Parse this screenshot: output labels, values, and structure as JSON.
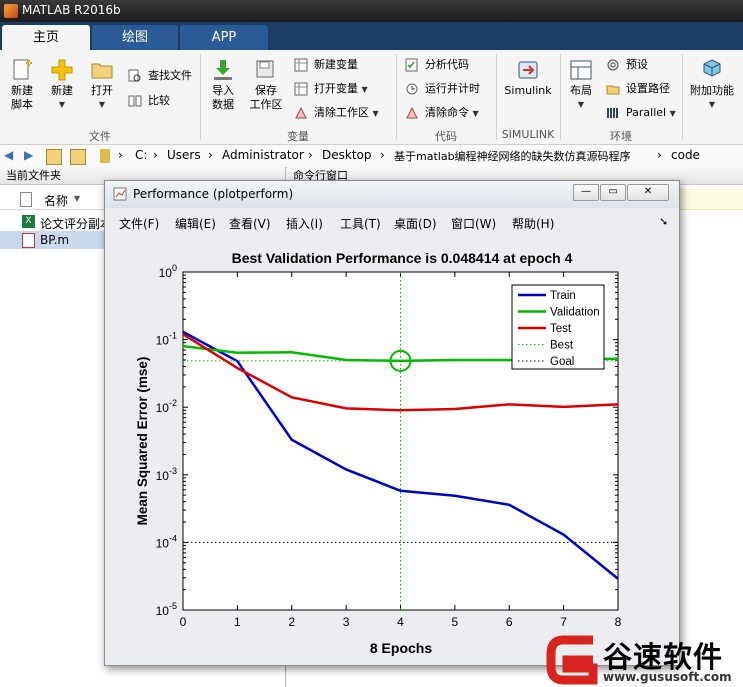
{
  "window": {
    "title": "MATLAB R2016b"
  },
  "tabs": [
    {
      "label": "主页"
    },
    {
      "label": "绘图"
    },
    {
      "label": "APP"
    }
  ],
  "ribbon": {
    "new_script": "新建\n脚本",
    "new": "新建",
    "open": "打开",
    "find_files": "查找文件",
    "compare": "比较",
    "import_data": "导入\n数据",
    "save_workspace": "保存\n工作区",
    "new_variable": "新建变量",
    "open_variable": "打开变量",
    "clear_workspace": "清除工作区",
    "analyze_code": "分析代码",
    "run_and_time": "运行并计时",
    "clear_commands": "清除命令",
    "simulink": "Simulink",
    "layout": "布局",
    "preferences": "预设",
    "set_path": "设置路径",
    "parallel": "Parallel",
    "addons": "附加功能",
    "groups": {
      "file": "文件",
      "variable": "变量",
      "code": "代码",
      "simulink": "SIMULINK",
      "environment": "环境"
    }
  },
  "address": {
    "crumbs": [
      "C:",
      "Users",
      "Administrator",
      "Desktop",
      "基于matlab编程神经网络的缺失数仿真源码程序",
      "code"
    ]
  },
  "left_panel": {
    "title": "当前文件夹",
    "col_name": "名称",
    "files": [
      {
        "name": "论文评分副本",
        "icon": "excel-icon"
      },
      {
        "name": "BP.m",
        "icon": "m-file-icon",
        "selected": true
      }
    ]
  },
  "cmd_panel": {
    "title": "命令行窗口"
  },
  "figure": {
    "title": "Performance (plotperform)",
    "menu": [
      "文件(F)",
      "编辑(E)",
      "查看(V)",
      "插入(I)",
      "工具(T)",
      "桌面(D)",
      "窗口(W)",
      "帮助(H)"
    ],
    "btn_min": "—",
    "btn_max": "▭",
    "btn_close": "✕"
  },
  "chart_data": {
    "type": "line",
    "title": "Best Validation Performance is 0.048414 at epoch 4",
    "xlabel": "8 Epochs",
    "ylabel": "Mean Squared Error  (mse)",
    "x": [
      0,
      1,
      2,
      3,
      4,
      5,
      6,
      7,
      8
    ],
    "xticks": [
      "0",
      "1",
      "2",
      "3",
      "4",
      "5",
      "6",
      "7",
      "8"
    ],
    "yscale": "log",
    "ylim": [
      1e-05,
      1
    ],
    "yticks": [
      {
        "base": "10",
        "exp": "0"
      },
      {
        "base": "10",
        "exp": "-1"
      },
      {
        "base": "10",
        "exp": "-2"
      },
      {
        "base": "10",
        "exp": "-3"
      },
      {
        "base": "10",
        "exp": "-4"
      },
      {
        "base": "10",
        "exp": "-5"
      }
    ],
    "series": [
      {
        "name": "Train",
        "color": "#0000cc",
        "style": "solid",
        "values": [
          0.13,
          0.048,
          0.0033,
          0.0012,
          0.00058,
          0.00049,
          0.00036,
          0.00013,
          2.9e-05
        ]
      },
      {
        "name": "Validation",
        "color": "#00bb00",
        "style": "solid",
        "values": [
          0.08,
          0.064,
          0.065,
          0.05,
          0.048414,
          0.05,
          0.05,
          0.051,
          0.052
        ]
      },
      {
        "name": "Test",
        "color": "#dd0000",
        "style": "solid",
        "values": [
          0.12,
          0.038,
          0.014,
          0.0096,
          0.009,
          0.0094,
          0.011,
          0.0101,
          0.011
        ]
      },
      {
        "name": "Best",
        "color": "#00bb00",
        "style": "dotted",
        "best_epoch": 4,
        "best_value": 0.048414
      },
      {
        "name": "Goal",
        "color": "#000000",
        "style": "dotted",
        "value": 0.0001
      }
    ],
    "grid": false,
    "legend": "top-right"
  },
  "watermark": {
    "brand": "谷速软件",
    "url": "www.gususoft.com"
  }
}
